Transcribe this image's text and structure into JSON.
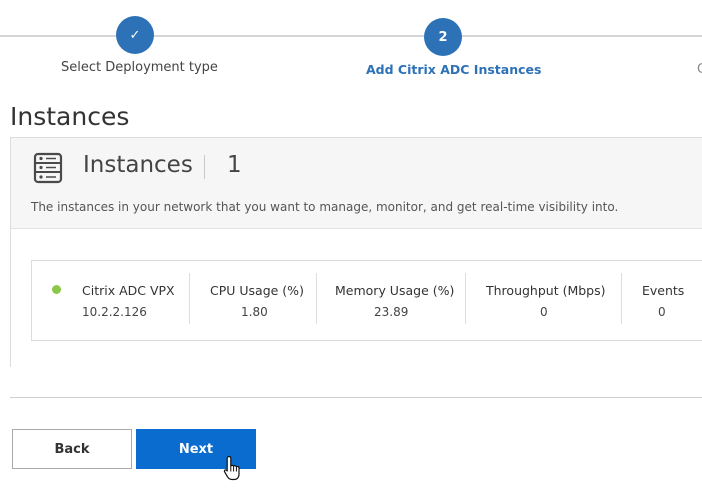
{
  "stepper": {
    "steps": [
      {
        "marker": "✓",
        "label": "Select Deployment type",
        "state": "done"
      },
      {
        "marker": "2",
        "label": "Add Citrix ADC Instances",
        "state": "active"
      },
      {
        "marker": "",
        "label": "C",
        "state": "upcoming"
      }
    ]
  },
  "section": {
    "title": "Instances"
  },
  "panel": {
    "icon": "server-rack-icon",
    "heading": "Instances",
    "count": "1",
    "description": "The instances in your network that you want to manage, monitor, and get real-time visibility into."
  },
  "instance_card": {
    "status_color": "#8bc84a",
    "columns": [
      {
        "header": "Citrix ADC VPX",
        "value": "10.2.2.126"
      },
      {
        "header": "CPU Usage (%)",
        "value": "1.80"
      },
      {
        "header": "Memory Usage (%)",
        "value": "23.89"
      },
      {
        "header": "Throughput (Mbps)",
        "value": "0"
      },
      {
        "header": "Events",
        "value": "0"
      }
    ]
  },
  "actions": {
    "back_label": "Back",
    "next_label": "Next"
  },
  "colors": {
    "accent": "#2d71b6",
    "primary_button": "#0a6cce",
    "status_ok": "#8bc84a"
  }
}
